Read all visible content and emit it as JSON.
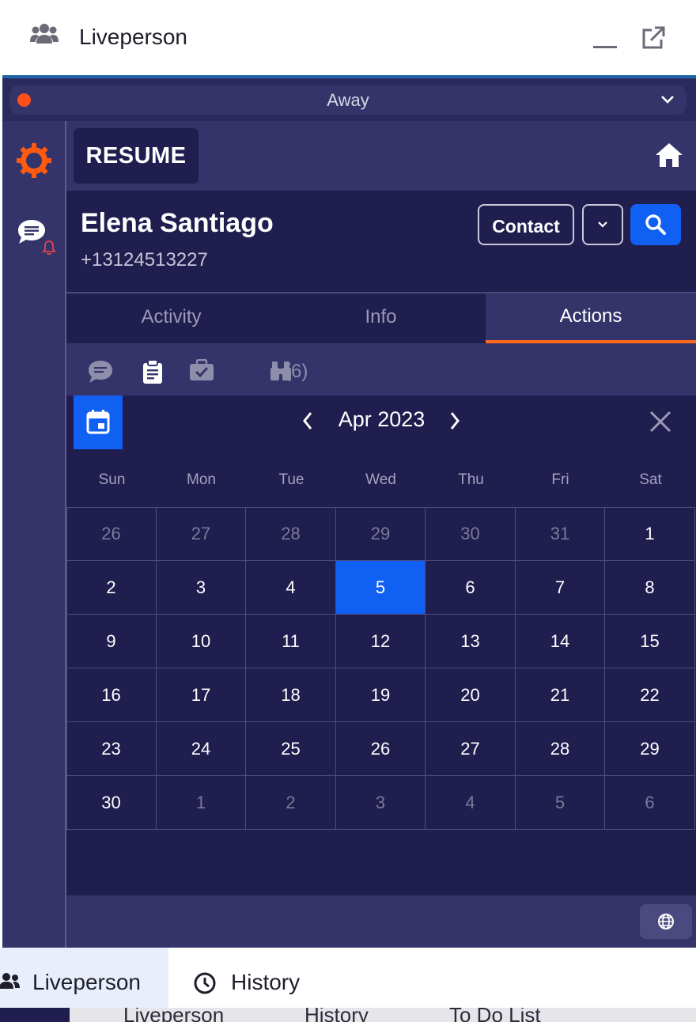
{
  "window": {
    "title": "Liveperson",
    "icons": {
      "app": "people-icon",
      "minimize": "minimize-icon",
      "popout": "popout-icon"
    }
  },
  "status": {
    "label": "Away",
    "dot_color": "#ff4e1a"
  },
  "sidebar": {
    "items": [
      {
        "icon": "gear-icon"
      },
      {
        "icon": "chat-bell-icon"
      }
    ]
  },
  "toolbar": {
    "resume_label": "RESUME",
    "home_icon": "home-icon"
  },
  "contact": {
    "name": "Elena Santiago",
    "phone": "+13124513227",
    "contact_button": "Contact",
    "search_icon": "search-icon"
  },
  "tabs": [
    {
      "label": "Activity",
      "active": false
    },
    {
      "label": "Info",
      "active": false
    },
    {
      "label": "Actions",
      "active": true
    }
  ],
  "actions": {
    "task_count": "(6)"
  },
  "calendar": {
    "month_label": "Apr 2023",
    "weekdays": [
      "Sun",
      "Mon",
      "Tue",
      "Wed",
      "Thu",
      "Fri",
      "Sat"
    ],
    "weeks": [
      [
        "26",
        "27",
        "28",
        "29",
        "30",
        "31",
        "1"
      ],
      [
        "2",
        "3",
        "4",
        "5",
        "6",
        "7",
        "8"
      ],
      [
        "9",
        "10",
        "11",
        "12",
        "13",
        "14",
        "15"
      ],
      [
        "16",
        "17",
        "18",
        "19",
        "20",
        "21",
        "22"
      ],
      [
        "23",
        "24",
        "25",
        "26",
        "27",
        "28",
        "29"
      ],
      [
        "30",
        "1",
        "2",
        "3",
        "4",
        "5",
        "6"
      ]
    ],
    "selected_day": "5"
  },
  "colors": {
    "accent": "#1160f4",
    "tab_underline": "#ff6a1a",
    "panel": "#201d4f",
    "frame": "#35346a"
  },
  "bottom_tabs": [
    {
      "label": "Liveperson",
      "icon": "people-icon",
      "active": true
    },
    {
      "label": "History",
      "icon": "clock-icon",
      "active": false
    }
  ],
  "background_tabs": [
    "Liveperson",
    "History",
    "To Do List"
  ]
}
